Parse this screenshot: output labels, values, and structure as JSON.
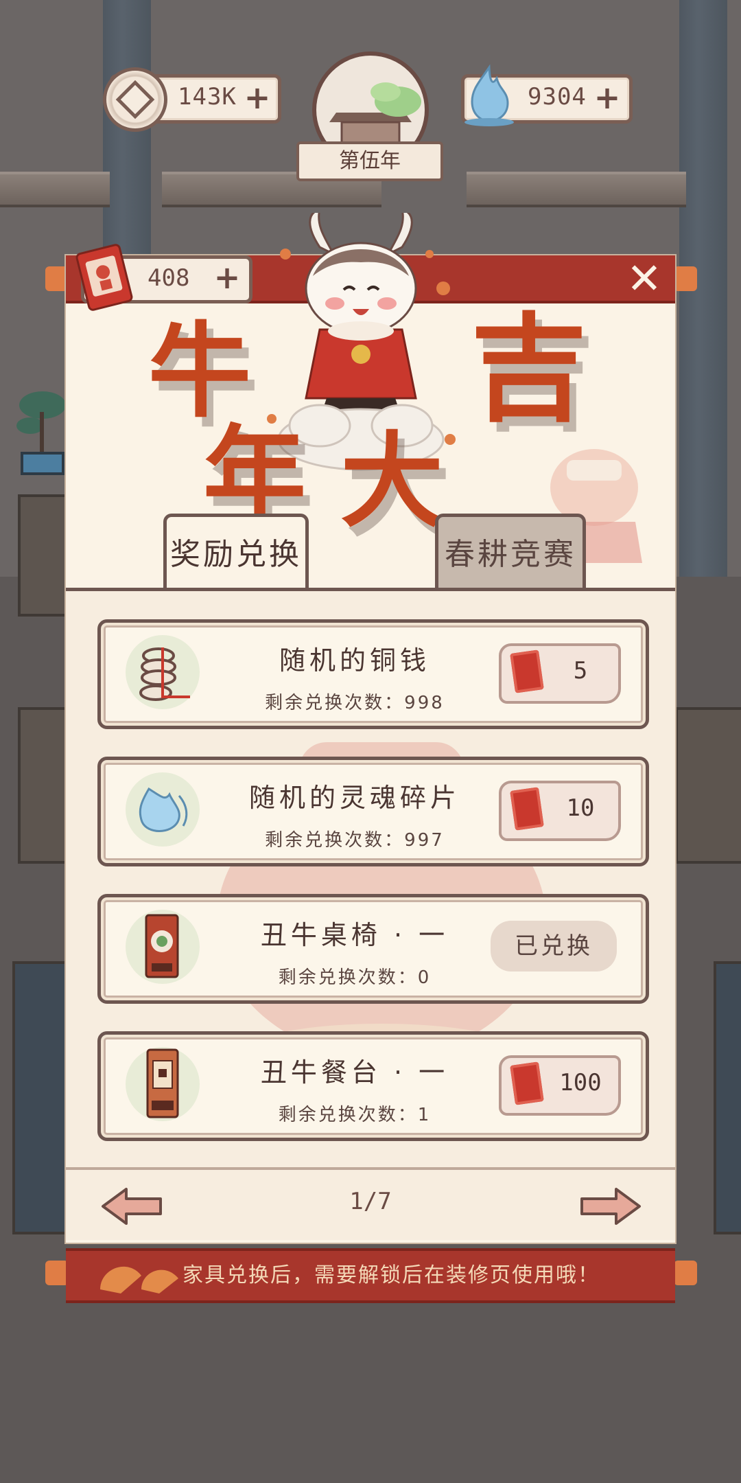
{
  "hud": {
    "coins": "143K",
    "souls": "9304",
    "year": "第伍年"
  },
  "event": {
    "banner_title": [
      "牛",
      "年",
      "大",
      "吉"
    ],
    "tickets": "408"
  },
  "tabs": [
    {
      "label": "奖励兑换",
      "active": true
    },
    {
      "label": "春耕竞赛",
      "active": false
    }
  ],
  "rewards": [
    {
      "name": "随机的铜钱",
      "remaining": "剩余兑换次数：998",
      "price": "5",
      "redeemed": false,
      "icon": "coin-string-icon"
    },
    {
      "name": "随机的灵魂碎片",
      "remaining": "剩余兑换次数：997",
      "price": "10",
      "redeemed": false,
      "icon": "soul-shard-icon"
    },
    {
      "name": "丑牛桌椅 · 一",
      "remaining": "剩余兑换次数：0",
      "status": "已兑换",
      "redeemed": true,
      "icon": "ox-table-chair-icon"
    },
    {
      "name": "丑牛餐台 · 一",
      "remaining": "剩余兑换次数：1",
      "price": "100",
      "redeemed": false,
      "icon": "ox-dining-table-icon"
    }
  ],
  "pager": {
    "page": "1/7"
  },
  "notice": "家具兑换后，需要解锁后在装修页使用哦！",
  "colors": {
    "accent_red": "#a8362c",
    "paper": "#fbf3e6",
    "frame_brown": "#6d5650",
    "banner_orange": "#c4461e"
  }
}
